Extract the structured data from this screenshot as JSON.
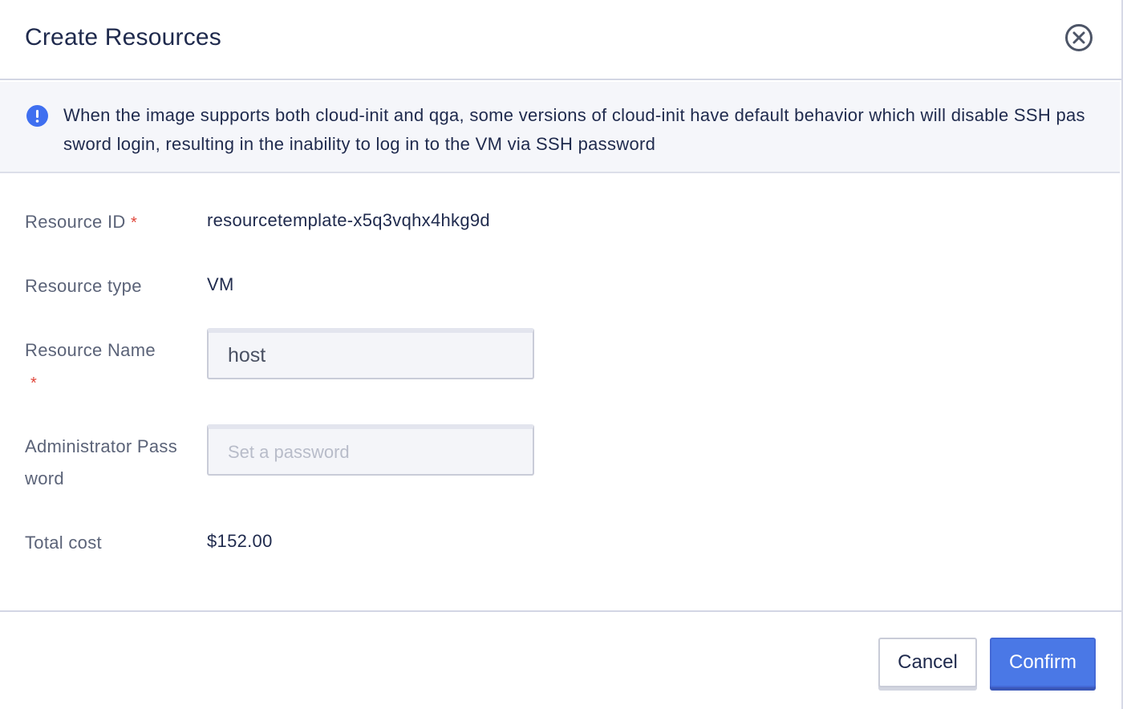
{
  "dialog": {
    "title": "Create Resources"
  },
  "alert": {
    "text": "When the image supports both cloud-init and qga, some versions of cloud-init have default behavior which will disable SSH password login, resulting in the inability to log in to the VM via SSH password"
  },
  "form": {
    "resource_id": {
      "label": "Resource ID",
      "required_mark": "*",
      "value": "resourcetemplate-x5q3vqhx4hkg9d"
    },
    "resource_type": {
      "label": "Resource type",
      "value": "VM"
    },
    "resource_name": {
      "label": "Resource Name",
      "required_mark": "*",
      "value": "host"
    },
    "admin_password": {
      "label": "Administrator Password",
      "placeholder": "Set a password",
      "value": ""
    },
    "total_cost": {
      "label": "Total cost",
      "value": "$152.00"
    }
  },
  "footer": {
    "cancel_label": "Cancel",
    "confirm_label": "Confirm"
  },
  "colors": {
    "primary": "#4a78e6",
    "info_icon": "#3f6ff0",
    "required": "#e0453a",
    "text": "#1f2a4d",
    "label": "#5b6378"
  },
  "icons": {
    "close": "close-circle-icon",
    "info": "info-icon"
  }
}
